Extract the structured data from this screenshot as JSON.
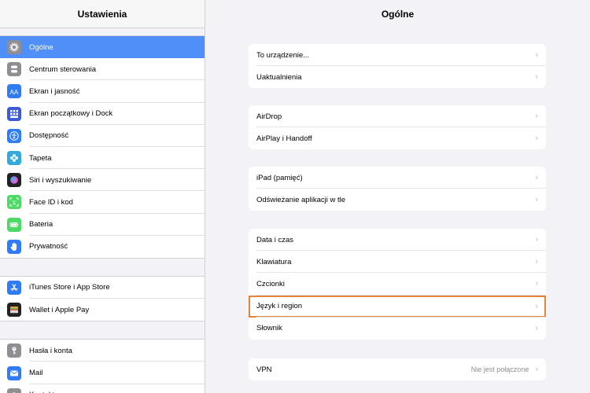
{
  "sidebar": {
    "title": "Ustawienia",
    "groups": [
      [
        {
          "label": "Ogólne",
          "icon": "gear-icon",
          "color": "#8e8e93",
          "selected": true
        },
        {
          "label": "Centrum sterowania",
          "icon": "toggles-icon",
          "color": "#8e8e93"
        },
        {
          "label": "Ekran i jasność",
          "icon": "text-size-icon",
          "color": "#2f7cf6"
        },
        {
          "label": "Ekran początkowy i Dock",
          "icon": "grid-icon",
          "color": "#3d5bd8"
        },
        {
          "label": "Dostępność",
          "icon": "accessibility-icon",
          "color": "#2f7cf6"
        },
        {
          "label": "Tapeta",
          "icon": "flower-icon",
          "color": "#33aadc"
        },
        {
          "label": "Siri i wyszukiwanie",
          "icon": "siri-icon",
          "color": "#222222"
        },
        {
          "label": "Face ID i kod",
          "icon": "face-id-icon",
          "color": "#4cd964"
        },
        {
          "label": "Bateria",
          "icon": "battery-icon",
          "color": "#4cd964"
        },
        {
          "label": "Prywatność",
          "icon": "hand-icon",
          "color": "#2f7cf6"
        }
      ],
      [
        {
          "label": "iTunes Store i App Store",
          "icon": "app-store-icon",
          "color": "#2f7cf6"
        },
        {
          "label": "Wallet i Apple Pay",
          "icon": "wallet-icon",
          "color": "#222222"
        }
      ],
      [
        {
          "label": "Hasła i konta",
          "icon": "key-icon",
          "color": "#8e8e93"
        },
        {
          "label": "Mail",
          "icon": "mail-icon",
          "color": "#2f7cf6"
        },
        {
          "label": "Kontakty",
          "icon": "contacts-icon",
          "color": "#8e8e93"
        }
      ]
    ]
  },
  "main": {
    "title": "Ogólne",
    "groups": [
      {
        "items": [
          {
            "label": "To urządzenie..."
          },
          {
            "label": "Uaktualnienia"
          }
        ]
      },
      {
        "items": [
          {
            "label": "AirDrop"
          },
          {
            "label": "AirPlay i Handoff"
          }
        ]
      },
      {
        "items": [
          {
            "label": "iPad (pamięć)"
          },
          {
            "label": "Odświeżanie aplikacji w tle"
          }
        ]
      },
      {
        "items": [
          {
            "label": "Data i czas"
          },
          {
            "label": "Klawiatura"
          },
          {
            "label": "Czcionki"
          },
          {
            "label": "Język i region",
            "highlight": true
          },
          {
            "label": "Słownik"
          }
        ]
      },
      {
        "items": [
          {
            "label": "VPN",
            "value": "Nie jest połączone"
          }
        ]
      }
    ],
    "highlight_color": "#e8833a"
  }
}
